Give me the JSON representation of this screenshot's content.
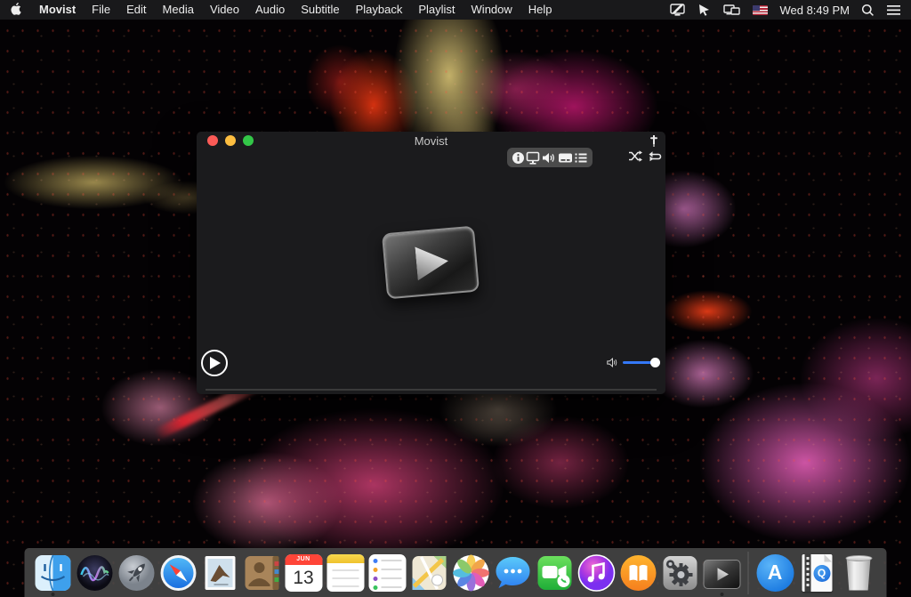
{
  "menu_bar": {
    "apple_icon": "apple-logo",
    "menus": [
      "Movist",
      "File",
      "Edit",
      "Media",
      "Video",
      "Audio",
      "Subtitle",
      "Playback",
      "Playlist",
      "Window",
      "Help"
    ],
    "clock": "Wed 8:49 PM",
    "status_icons": [
      "display-mirroring-icon",
      "pointer-device-icon",
      "displays-icon",
      "us-flag-icon",
      "spotlight-search-icon",
      "notification-center-icon"
    ]
  },
  "window": {
    "title": "Movist",
    "titlebar_buttons": [
      "close",
      "minimize",
      "zoom"
    ],
    "pin_icon": "always-on-top-pin",
    "toolbar_icons": [
      "info",
      "video-display",
      "volume",
      "subtitle",
      "playlist"
    ],
    "transport_icons": [
      "shuffle",
      "repeat"
    ],
    "center_logo": "movist-play-logo",
    "bottom_controls": {
      "play_button": "play",
      "volume_percent": 100
    },
    "accent_blue": "#3478f6"
  },
  "dock": {
    "items": [
      "Finder",
      "Siri",
      "Launchpad",
      "Safari",
      "Mail",
      "Contacts",
      "Calendar",
      "Notes",
      "Reminders",
      "Maps",
      "Photos",
      "Messages",
      "FaceTime",
      "iTunes",
      "iBooks",
      "System Preferences",
      "Movist",
      "App Store",
      "QuickTime Document",
      "Trash"
    ],
    "running": [
      "Finder",
      "Movist"
    ],
    "calendar": {
      "month": "JUN",
      "day": "13"
    },
    "app_store_letter": "A",
    "quicktime_letter": "Q"
  },
  "colors": {
    "traffic_red": "#fc5b57",
    "traffic_yellow": "#fdbe40",
    "traffic_green": "#33c748",
    "menu_bar_bg": "#19191b",
    "window_bg": "#1b1b1d",
    "dock_bg": "#484848"
  }
}
